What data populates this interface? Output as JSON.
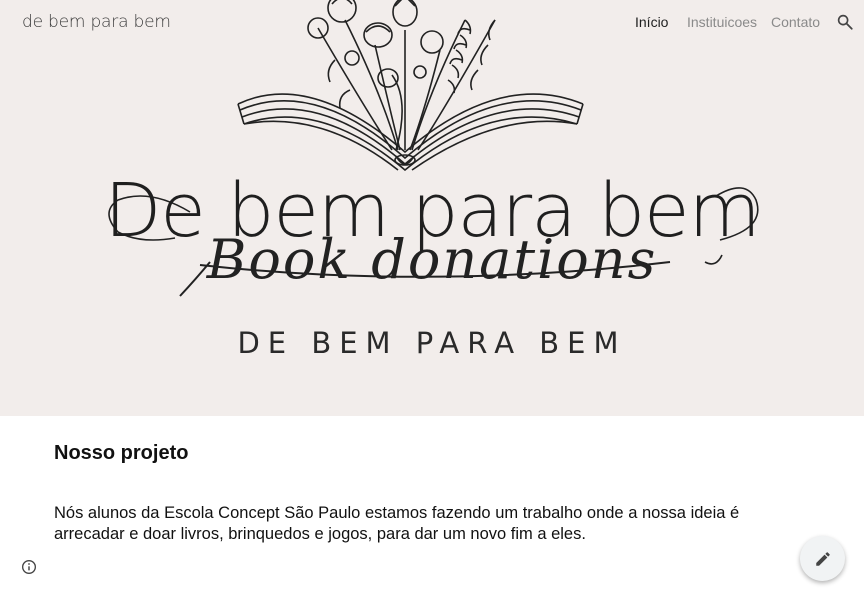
{
  "site": {
    "title": "de bem para bem"
  },
  "nav": {
    "items": [
      {
        "label": "Início"
      },
      {
        "label": "Instituicoes"
      },
      {
        "label": "Contato"
      }
    ]
  },
  "icons": {
    "search": "search-icon",
    "info": "info-icon",
    "edit": "pencil-icon"
  },
  "hero": {
    "title": "De bem para bem",
    "script_text": "Book donations",
    "caps_text": "DE BEM PARA BEM"
  },
  "content": {
    "heading": "Nosso projeto",
    "paragraph": "Nós alunos da Escola Concept São Paulo estamos fazendo um trabalho onde a nossa ideia é arrecadar e doar livros, brinquedos e jogos, para dar um novo fim a eles."
  },
  "colors": {
    "hero_bg": "#f2edeb",
    "active_nav": "#1f1f1f",
    "inactive_nav": "#8a8a8a"
  }
}
